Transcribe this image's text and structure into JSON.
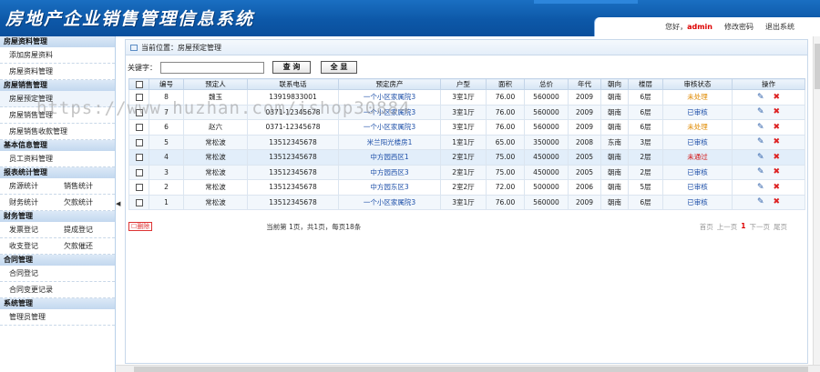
{
  "app": {
    "title": "房地产企业销售管理信息系统"
  },
  "userbar": {
    "greeting": "您好，",
    "user": "admin",
    "change_pwd": "修改密码",
    "logout": "退出系统"
  },
  "sidebar": {
    "sections": [
      {
        "title": "房屋资料管理",
        "items": [
          "添加房屋资料",
          "房屋资料管理"
        ]
      },
      {
        "title": "房屋销售管理",
        "items": [
          "房屋预定管理",
          "房屋销售管理",
          "房屋销售收款管理"
        ]
      },
      {
        "title": "基本信息管理",
        "items": [
          "员工资料管理"
        ]
      },
      {
        "title": "报表统计管理",
        "pairs": [
          [
            "房源统计",
            "销售统计"
          ],
          [
            "财务统计",
            "欠款统计"
          ]
        ]
      },
      {
        "title": "财务管理",
        "pairs": [
          [
            "发票登记",
            "提成登记"
          ],
          [
            "收支登记",
            "欠款催还"
          ]
        ]
      },
      {
        "title": "合同管理",
        "items": [
          "合同登记",
          "合同变更记录"
        ]
      },
      {
        "title": "系统管理",
        "items": [
          "管理员管理"
        ]
      }
    ]
  },
  "breadcrumb": {
    "label": "当前位置：房屋预定管理"
  },
  "search": {
    "label": "关键字：",
    "value": "",
    "query_btn": "查 询",
    "all_btn": "全 显"
  },
  "table": {
    "headers": [
      "",
      "编号",
      "预定人",
      "联系电话",
      "预定房产",
      "户型",
      "面积",
      "总价",
      "年代",
      "朝向",
      "楼层",
      "审核状态",
      "操作"
    ],
    "rows": [
      {
        "id": "8",
        "name": "魏玉",
        "phone": "13919833001",
        "property": "一个小区家属院3",
        "type": "3室1厅",
        "area": "76.00",
        "price": "560000",
        "year": "2009",
        "facing": "朝南",
        "floor": "6层",
        "status": "未处理",
        "status_class": "pending"
      },
      {
        "id": "7",
        "name": "",
        "phone": "0371-12345678",
        "property": "一个小区家属院3",
        "type": "3室1厅",
        "area": "76.00",
        "price": "560000",
        "year": "2009",
        "facing": "朝南",
        "floor": "6层",
        "status": "已审核",
        "status_class": "ok"
      },
      {
        "id": "6",
        "name": "赵六",
        "phone": "0371-12345678",
        "property": "一个小区家属院3",
        "type": "3室1厅",
        "area": "76.00",
        "price": "560000",
        "year": "2009",
        "facing": "朝南",
        "floor": "6层",
        "status": "未处理",
        "status_class": "pending"
      },
      {
        "id": "5",
        "name": "常松波",
        "phone": "13512345678",
        "property": "米兰阳光楼房1",
        "type": "1室1厅",
        "area": "65.00",
        "price": "350000",
        "year": "2008",
        "facing": "东南",
        "floor": "3层",
        "status": "已审核",
        "status_class": "ok"
      },
      {
        "id": "4",
        "name": "常松波",
        "phone": "13512345678",
        "property": "中方园西区1",
        "type": "2室1厅",
        "area": "75.00",
        "price": "450000",
        "year": "2005",
        "facing": "朝南",
        "floor": "2层",
        "status": "未通过",
        "status_class": "fail"
      },
      {
        "id": "3",
        "name": "常松波",
        "phone": "13512345678",
        "property": "中方园西区3",
        "type": "2室1厅",
        "area": "75.00",
        "price": "450000",
        "year": "2005",
        "facing": "朝南",
        "floor": "2层",
        "status": "已审核",
        "status_class": "ok"
      },
      {
        "id": "2",
        "name": "常松波",
        "phone": "13512345678",
        "property": "中方园东区3",
        "type": "2室2厅",
        "area": "72.00",
        "price": "500000",
        "year": "2006",
        "facing": "朝南",
        "floor": "5层",
        "status": "已审核",
        "status_class": "ok"
      },
      {
        "id": "1",
        "name": "常松波",
        "phone": "13512345678",
        "property": "一个小区家属院3",
        "type": "3室1厅",
        "area": "76.00",
        "price": "560000",
        "year": "2009",
        "facing": "朝南",
        "floor": "6层",
        "status": "已审核",
        "status_class": "ok"
      }
    ]
  },
  "footer": {
    "delete_btn": "删除",
    "page_info": "当前第 1页，共1页，每页18条",
    "pager": {
      "first": "首页",
      "prev": "上一页",
      "current": "1",
      "next": "下一页",
      "last": "尾页"
    }
  },
  "watermark": "https://www.huzhan.com/ishop30884",
  "colors": {
    "header": "#0d58a8",
    "accent": "#1d4fa8",
    "pending": "#e08a00",
    "fail": "#d21010"
  }
}
